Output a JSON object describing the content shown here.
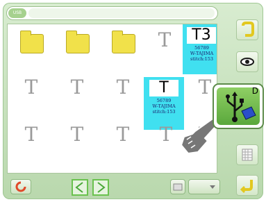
{
  "pathbar": {
    "tag": "USB",
    "value": ""
  },
  "items": [
    {
      "kind": "folder",
      "label": "",
      "sub": ""
    },
    {
      "kind": "folder",
      "label": "",
      "sub": ""
    },
    {
      "kind": "folder",
      "label": "",
      "sub": ""
    },
    {
      "kind": "tfile",
      "label": "",
      "sub": ""
    },
    {
      "kind": "tfile",
      "label": "",
      "sub": ""
    },
    {
      "kind": "tfile",
      "label": "",
      "sub": ""
    },
    {
      "kind": "tfile",
      "label": "",
      "sub": ""
    },
    {
      "kind": "tfile",
      "label": "",
      "sub": ""
    },
    {
      "kind": "tfile",
      "label": "",
      "sub": ""
    },
    {
      "kind": "tfile",
      "label": "",
      "sub": ""
    },
    {
      "kind": "tfile",
      "label": "",
      "sub": ""
    },
    {
      "kind": "tfile",
      "label": "",
      "sub": ""
    },
    {
      "kind": "tfile",
      "label": "",
      "sub": ""
    },
    {
      "kind": "tfile",
      "label": "",
      "sub": ""
    }
  ],
  "highlight_t3": {
    "glyph": "T3",
    "lines": "56789\nW-TAJIMA\nstitch:153"
  },
  "highlight_t": {
    "glyph": "T",
    "lines": "56789\nW-TAJIMA\nstitch:153"
  },
  "usb_button": {
    "letter": "D"
  },
  "bottom": {
    "page_text": "",
    "mode_text": ""
  },
  "colors": {
    "accent": "#40e0f0",
    "frame": "#b9d8ad",
    "usb": "#5aa83c",
    "arrow": "#6ac24e"
  }
}
